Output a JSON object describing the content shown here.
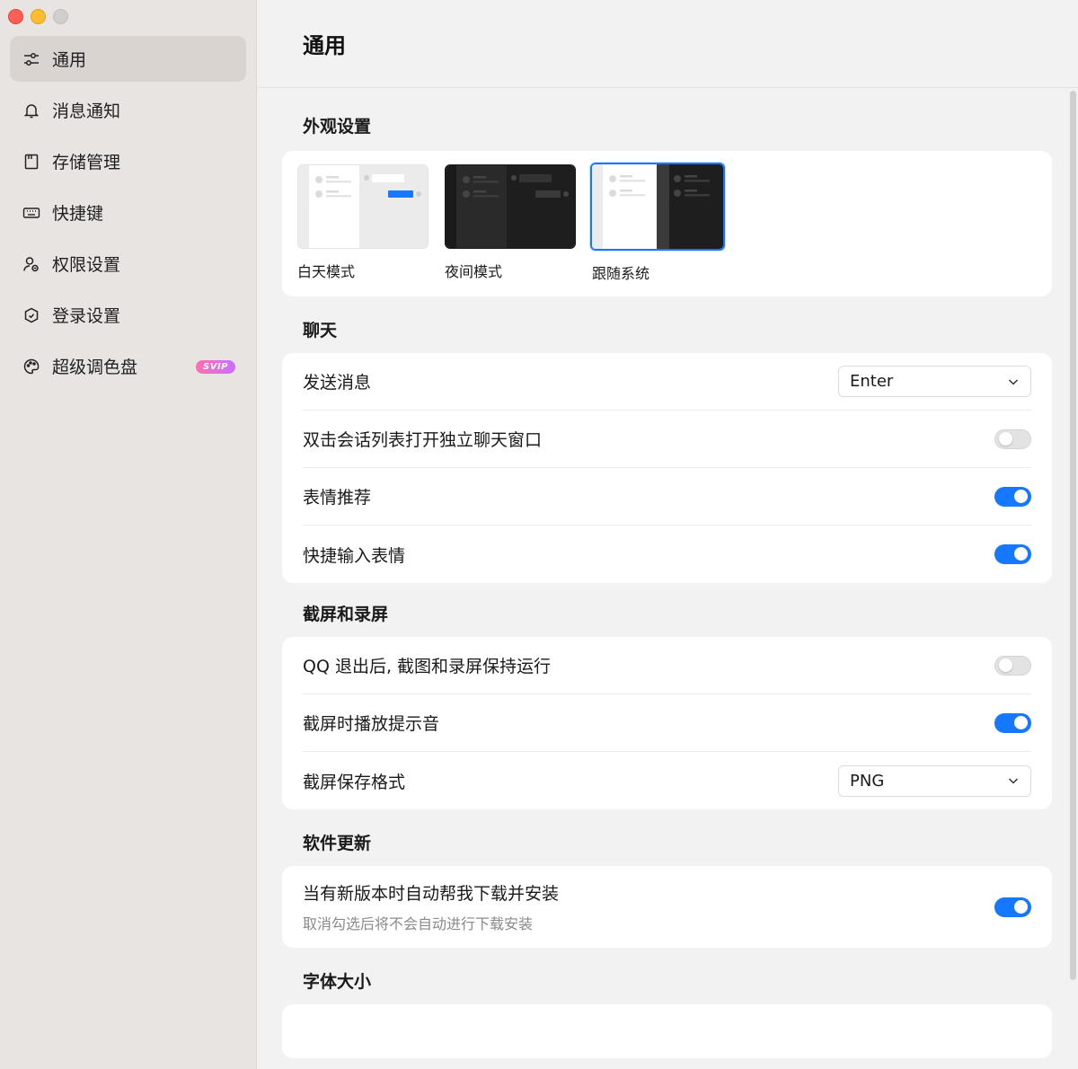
{
  "sidebar": {
    "items": [
      {
        "label": "通用",
        "icon": "sliders-icon",
        "active": true
      },
      {
        "label": "消息通知",
        "icon": "bell-icon"
      },
      {
        "label": "存储管理",
        "icon": "storage-icon"
      },
      {
        "label": "快捷键",
        "icon": "keyboard-icon"
      },
      {
        "label": "权限设置",
        "icon": "user-permission-icon"
      },
      {
        "label": "登录设置",
        "icon": "shield-icon"
      },
      {
        "label": "超级调色盘",
        "icon": "palette-icon",
        "badge": "SVIP"
      }
    ]
  },
  "main": {
    "title": "通用",
    "appearance": {
      "title": "外观设置",
      "options": [
        {
          "label": "白天模式"
        },
        {
          "label": "夜间模式"
        },
        {
          "label": "跟随系统",
          "selected": true
        }
      ]
    },
    "chat": {
      "title": "聊天",
      "rows": [
        {
          "label": "发送消息",
          "type": "select",
          "value": "Enter"
        },
        {
          "label": "双击会话列表打开独立聊天窗口",
          "type": "toggle",
          "on": false
        },
        {
          "label": "表情推荐",
          "type": "toggle",
          "on": true
        },
        {
          "label": "快捷输入表情",
          "type": "toggle",
          "on": true
        }
      ]
    },
    "screenshot": {
      "title": "截屏和录屏",
      "rows": [
        {
          "label": "QQ 退出后, 截图和录屏保持运行",
          "type": "toggle",
          "on": false
        },
        {
          "label": "截屏时播放提示音",
          "type": "toggle",
          "on": true
        },
        {
          "label": "截屏保存格式",
          "type": "select",
          "value": "PNG"
        }
      ]
    },
    "update": {
      "title": "软件更新",
      "label": "当有新版本时自动帮我下载并安装",
      "sub": "取消勾选后将不会自动进行下载安装",
      "on": true
    },
    "font": {
      "title": "字体大小"
    }
  },
  "colors": {
    "accent": "#1677ff",
    "sidebar_bg": "#e8e4e1",
    "active_item_bg": "#d9d4d0"
  }
}
